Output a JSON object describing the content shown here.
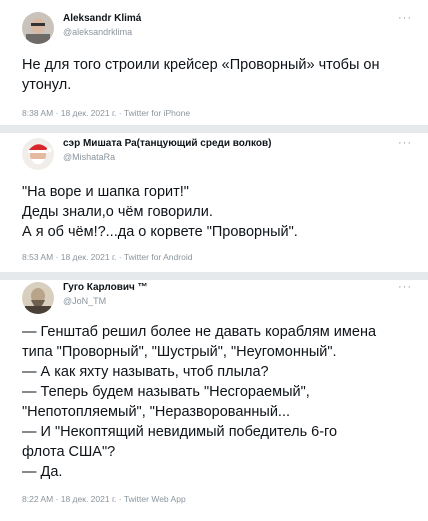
{
  "tweets": [
    {
      "author_name": "Aleksandr Klimá",
      "author_handle": "@aleksandrklima",
      "more_label": "···",
      "lines": [
        "Не для того строили крейсер «Проворный» чтобы он",
        "утонул."
      ],
      "meta": "8:38 AM · 18 дек. 2021 г. · Twitter for iPhone"
    },
    {
      "author_name": "сэр Мишата Ра(танцующий среди волков)",
      "author_handle": "@MishataRa",
      "more_label": "···",
      "lines": [
        "\"На воре и шапка горит!\"",
        "Деды знали,о чём говорили.",
        "А я об чём!?...да о корвете \"Проворный\"."
      ],
      "meta": "8:53 AM · 18 дек. 2021 г. · Twitter for Android"
    },
    {
      "author_name": "Гуго Карлович ™",
      "author_handle": "@JoN_TM",
      "more_label": "···",
      "lines": [
        "— Генштаб решил более не давать кораблям имена",
        "типа \"Проворный\", \"Шустрый\", \"Неугомонный\".",
        "— А как яхту называть, чтоб плыла?",
        "— Теперь будем называть \"Несгораемый\",",
        "\"Непотопляемый\", \"Неразворованный...",
        "— И \"Некоптящий невидимый победитель 6-го",
        "флота США\"?",
        "— Да."
      ],
      "meta": "8:22 AM · 18 дек. 2021 г. · Twitter Web App"
    }
  ]
}
